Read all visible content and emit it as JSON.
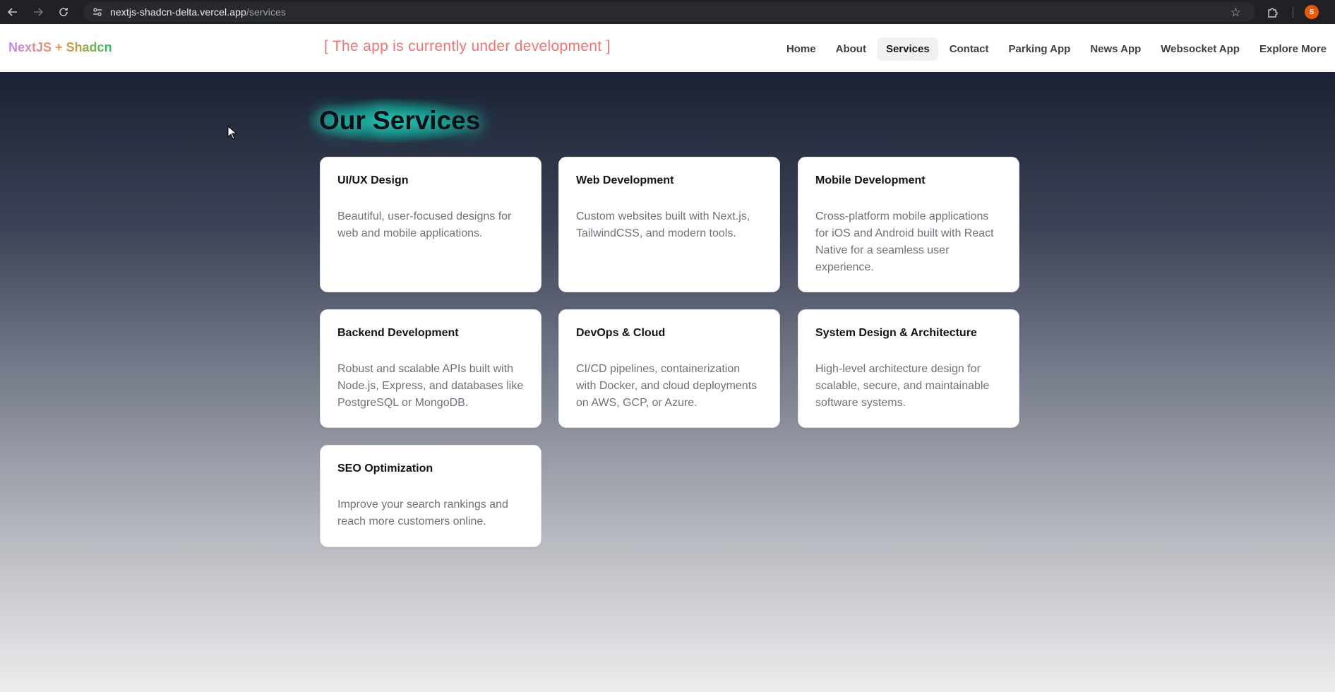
{
  "browser": {
    "url_host": "nextjs-shadcn-delta.vercel.app",
    "url_path": "/services",
    "profile_initial": "S"
  },
  "header": {
    "logo": "NextJS + Shadcn",
    "dev_note": "[ The app is currently under development ]",
    "nav": [
      {
        "label": "Home"
      },
      {
        "label": "About"
      },
      {
        "label": "Services"
      },
      {
        "label": "Contact"
      },
      {
        "label": "Parking App"
      },
      {
        "label": "News App"
      },
      {
        "label": "Websocket App"
      },
      {
        "label": "Explore More"
      }
    ],
    "active_nav": "Services"
  },
  "page": {
    "title": "Our Services",
    "services": [
      {
        "title": "UI/UX Design",
        "description": "Beautiful, user-focused designs for web and mobile applications."
      },
      {
        "title": "Web Development",
        "description": "Custom websites built with Next.js, TailwindCSS, and modern tools."
      },
      {
        "title": "Mobile Development",
        "description": "Cross-platform mobile applications for iOS and Android built with React Native for a seamless user experience."
      },
      {
        "title": "Backend Development",
        "description": "Robust and scalable APIs built with Node.js, Express, and databases like PostgreSQL or MongoDB."
      },
      {
        "title": "DevOps & Cloud",
        "description": "CI/CD pipelines, containerization with Docker, and cloud deployments on AWS, GCP, or Azure."
      },
      {
        "title": "System Design & Architecture",
        "description": "High-level architecture design for scalable, secure, and maintainable software systems."
      },
      {
        "title": "SEO Optimization",
        "description": "Improve your search rankings and reach more customers online."
      }
    ]
  },
  "colors": {
    "dev_note": "#f87171",
    "title_glow": "#2dd4bf",
    "profile": "#e8590c"
  }
}
